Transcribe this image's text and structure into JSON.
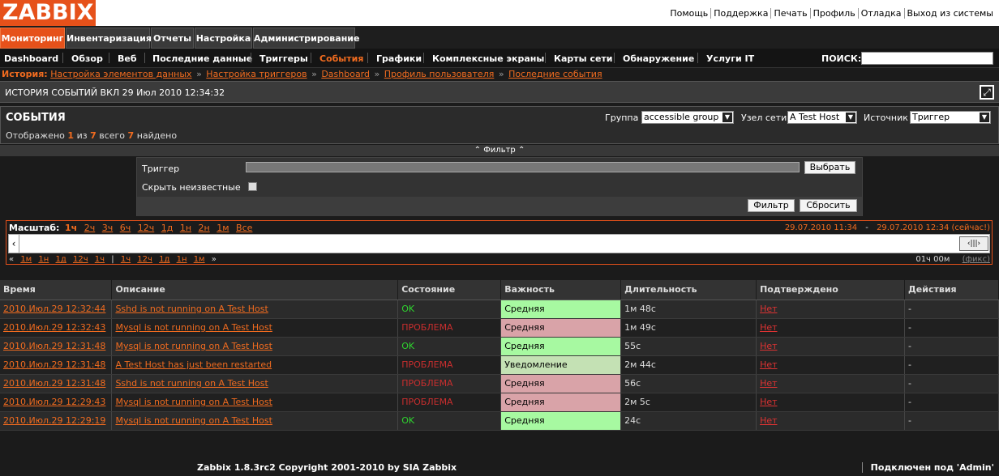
{
  "logo": "ZABBIX",
  "top_links": [
    "Помощь",
    "Поддержка",
    "Печать",
    "Профиль",
    "Отладка",
    "Выход из системы"
  ],
  "main_menu": [
    {
      "label": "Мониторинг",
      "active": true
    },
    {
      "label": "Инвентаризация",
      "active": false
    },
    {
      "label": "Отчеты",
      "active": false
    },
    {
      "label": "Настройка",
      "active": false
    },
    {
      "label": "Администрирование",
      "active": false
    }
  ],
  "sub_menu": [
    {
      "label": "Dashboard",
      "active": false
    },
    {
      "label": "Обзор",
      "active": false
    },
    {
      "label": "Веб",
      "active": false
    },
    {
      "label": "Последние данные",
      "active": false
    },
    {
      "label": "Триггеры",
      "active": false
    },
    {
      "label": "События",
      "active": true
    },
    {
      "label": "Графики",
      "active": false
    },
    {
      "label": "Комплексные экраны",
      "active": false
    },
    {
      "label": "Карты сети",
      "active": false
    },
    {
      "label": "Обнаружение",
      "active": false
    },
    {
      "label": "Услуги IT",
      "active": false
    }
  ],
  "search": {
    "label": "ПОИСК:",
    "value": ""
  },
  "history": {
    "label": "История:",
    "items": [
      "Настройка элементов данных",
      "Настройка триггеров",
      "Dashboard",
      "Профиль пользователя",
      "Последние события"
    ]
  },
  "title_bar": "ИСТОРИЯ СОБЫТИЙ ВКЛ 29 Июл 2010 12:34:32",
  "events_header": {
    "title": "СОБЫТИЯ",
    "count_prefix": "Отображено",
    "count_shown": "1",
    "count_of": "из",
    "count_total_num": "7",
    "count_total_label": "всего",
    "count_found_num": "7",
    "count_found_label": "найдено",
    "group_label": "Группа",
    "group_value": "accessible group",
    "host_label": "Узел сети",
    "host_value": "A Test Host",
    "source_label": "Источник",
    "source_value": "Триггер"
  },
  "filter": {
    "toggle_label": "Фильтр",
    "trigger_label": "Триггер",
    "trigger_value": "",
    "select_button": "Выбрать",
    "hide_unknown_label": "Скрыть неизвестные",
    "hide_unknown_checked": false,
    "filter_button": "Фильтр",
    "reset_button": "Сбросить"
  },
  "scale": {
    "label": "Масштаб:",
    "links": [
      "1ч",
      "2ч",
      "3ч",
      "6ч",
      "12ч",
      "1д",
      "1н",
      "2н",
      "1м",
      "Все"
    ],
    "active_link": "1ч",
    "date_from": "29.07.2010 11:34",
    "date_to": "29.07.2010 12:34 (сейчас!)",
    "nav_left": [
      "«",
      "1м",
      "1н",
      "1д",
      "12ч",
      "1ч"
    ],
    "nav_right": [
      "1ч",
      "12ч",
      "1д",
      "1н",
      "1м",
      "»"
    ],
    "period": "01ч 00м",
    "fixed": "(фикс)"
  },
  "table": {
    "columns": [
      "Время",
      "Описание",
      "Состояние",
      "Важность",
      "Длительность",
      "Подтверждено",
      "Действия"
    ],
    "rows": [
      {
        "time": "2010.Июл.29 12:32:44",
        "desc": "Sshd is not running on A Test Host",
        "state": "OK",
        "state_type": "ok",
        "severity": "Средняя",
        "sev_type": "avg",
        "duration": "1м 48с",
        "ack": "Нет",
        "actions": "-"
      },
      {
        "time": "2010.Июл.29 12:32:43",
        "desc": "Mysql is not running on A Test Host",
        "state": "ПРОБЛЕМА",
        "state_type": "pr",
        "severity": "Средняя",
        "sev_type": "high",
        "duration": "1м 49с",
        "ack": "Нет",
        "actions": "-"
      },
      {
        "time": "2010.Июл.29 12:31:48",
        "desc": "Mysql is not running on A Test Host",
        "state": "OK",
        "state_type": "ok",
        "severity": "Средняя",
        "sev_type": "avg",
        "duration": "55с",
        "ack": "Нет",
        "actions": "-"
      },
      {
        "time": "2010.Июл.29 12:31:48",
        "desc": "A Test Host has just been restarted",
        "state": "ПРОБЛЕМА",
        "state_type": "pr",
        "severity": "Уведомление",
        "sev_type": "info",
        "duration": "2м 44с",
        "ack": "Нет",
        "actions": "-"
      },
      {
        "time": "2010.Июл.29 12:31:48",
        "desc": "Sshd is not running on A Test Host",
        "state": "ПРОБЛЕМА",
        "state_type": "pr",
        "severity": "Средняя",
        "sev_type": "high",
        "duration": "56с",
        "ack": "Нет",
        "actions": "-"
      },
      {
        "time": "2010.Июл.29 12:29:43",
        "desc": "Mysql is not running on A Test Host",
        "state": "ПРОБЛЕМА",
        "state_type": "pr",
        "severity": "Средняя",
        "sev_type": "high",
        "duration": "2м 5с",
        "ack": "Нет",
        "actions": "-"
      },
      {
        "time": "2010.Июл.29 12:29:19",
        "desc": "Mysql is not running on A Test Host",
        "state": "OK",
        "state_type": "ok",
        "severity": "Средняя",
        "sev_type": "avg",
        "duration": "24с",
        "ack": "Нет",
        "actions": "-"
      }
    ]
  },
  "footer": {
    "copyright": "Zabbix 1.8.3rc2 Copyright 2001-2010 by SIA Zabbix",
    "connected": "Подключен под 'Admin'"
  }
}
